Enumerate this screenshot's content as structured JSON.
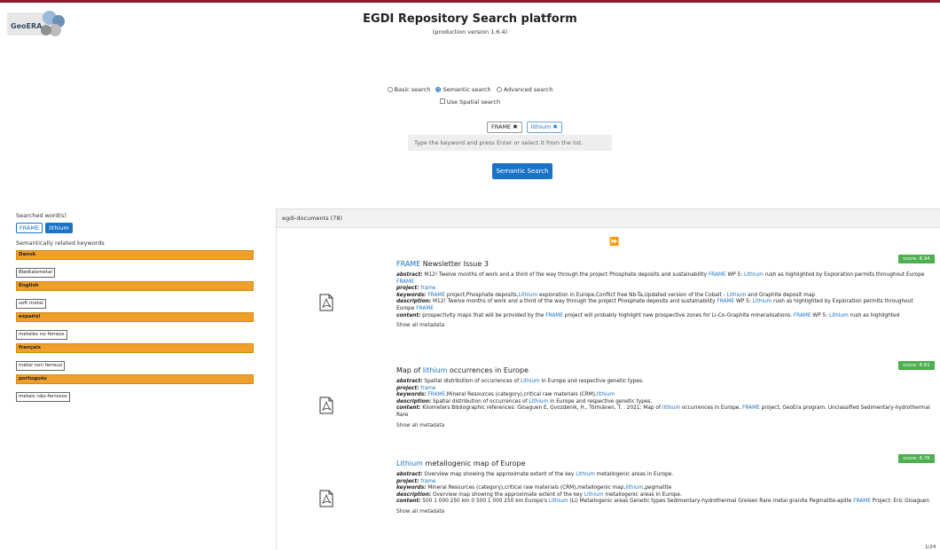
{
  "header": {
    "title": "EGDI Repository Search platform",
    "subtitle": "(production version 1.6.4)",
    "logo_text": "GeoERA"
  },
  "search": {
    "modes": [
      "Basic search",
      "Semantic search",
      "Advanced search"
    ],
    "selected_mode": "Semantic search",
    "spatial_label": "Use Spatial search",
    "chips": [
      "FRAME",
      "lithium"
    ],
    "input_placeholder": "Type the keyword and press Enter or select it from the list.",
    "button_label": "Semantic Search"
  },
  "left_panel": {
    "searched_label": "Searched word(s)",
    "searched_words": [
      "FRAME",
      "lithium"
    ],
    "related_label": "Semantically related keywords",
    "languages": [
      {
        "lang": "Dansk",
        "keywords": [
          "Blødtalsmetal"
        ]
      },
      {
        "lang": "English",
        "keywords": [
          "soft metal"
        ]
      },
      {
        "lang": "español",
        "keywords": [
          "metales no férreos"
        ]
      },
      {
        "lang": "français",
        "keywords": [
          "métal non ferreux"
        ]
      },
      {
        "lang": "português",
        "keywords": [
          "metais não-ferrosos"
        ]
      }
    ]
  },
  "results": {
    "header": "egdi-documents (78)",
    "pager_icon": "fast-forward-icon",
    "show_meta_label": "Show all metadata",
    "items": [
      {
        "title_parts": [
          [
            "FRAME",
            true
          ],
          [
            " Newsletter Issue 3",
            false
          ]
        ],
        "score": "score: 8.94",
        "rows": [
          {
            "k": "abstract:",
            "parts": [
              [
                " M12! Twelve months of work and a third of the way through the project Phosphate deposits and sustainability ",
                false
              ],
              [
                "FRAME",
                true
              ],
              [
                " WP 5: ",
                false
              ],
              [
                "Lithium",
                true
              ],
              [
                " rush as highlighted by Exploration permits throughout Europe ",
                false
              ],
              [
                "FRAME",
                true
              ]
            ]
          },
          {
            "k": "project:",
            "parts": [
              [
                " frame",
                true
              ]
            ]
          },
          {
            "k": "keywords:",
            "parts": [
              [
                " ",
                false
              ],
              [
                "FRAME",
                true
              ],
              [
                " project,Phosphate deposits,",
                false
              ],
              [
                "Lithium",
                true
              ],
              [
                " exploration in Europe,Conflict free Nb-Ta,Updated version of the Cobalt - ",
                false
              ],
              [
                "Lithium",
                true
              ],
              [
                " and Graphite deposit map",
                false
              ]
            ]
          },
          {
            "k": "description:",
            "parts": [
              [
                " M12! Twelve months of work and a third of the way through the project Phosphate deposits and sustainability ",
                false
              ],
              [
                "FRAME",
                true
              ],
              [
                " WP 5: ",
                false
              ],
              [
                "Lithium",
                true
              ],
              [
                " rush as highlighted by Exploration permits throughout Europe ",
                false
              ],
              [
                "FRAME",
                true
              ]
            ]
          },
          {
            "k": "content:",
            "parts": [
              [
                " prospectivity maps that will be provided by the ",
                false
              ],
              [
                "FRAME",
                true
              ],
              [
                " project will probably highlight new prospective zones for Li-Co-Graphite mineralisations. ",
                false
              ],
              [
                "FRAME",
                true
              ],
              [
                " WP 5: ",
                false
              ],
              [
                "Lithium",
                true
              ],
              [
                " rush as highlighted",
                false
              ]
            ]
          }
        ]
      },
      {
        "title_parts": [
          [
            "Map of ",
            false
          ],
          [
            "lithium",
            true
          ],
          [
            " occurrences in Europe",
            false
          ]
        ],
        "score": "score: 8.81",
        "rows": [
          {
            "k": "abstract:",
            "parts": [
              [
                " Spatial distribution of occurrences of ",
                false
              ],
              [
                "Lithium",
                true
              ],
              [
                " in Europe and respective genetic types.",
                false
              ]
            ]
          },
          {
            "k": "project:",
            "parts": [
              [
                " frame",
                true
              ]
            ]
          },
          {
            "k": "keywords:",
            "parts": [
              [
                " ",
                false
              ],
              [
                "FRAME",
                true
              ],
              [
                ",Mineral Resources (category),critical raw materials (CRM),",
                false
              ],
              [
                "lithium",
                true
              ]
            ]
          },
          {
            "k": "description:",
            "parts": [
              [
                " Spatial distribution of occurrences of ",
                false
              ],
              [
                "Lithium",
                true
              ],
              [
                " in Europe and respective genetic types.",
                false
              ]
            ]
          },
          {
            "k": "content:",
            "parts": [
              [
                " Kilometers Bibliographic references: Gloaguen E, Gvozdenik, H., Törmänen, T. . 2021: Map of ",
                false
              ],
              [
                "lithium",
                true
              ],
              [
                " occurrences in Europe, ",
                false
              ],
              [
                "FRAME",
                true
              ],
              [
                " project, GeoEra program. Unclassified Sedimentary-hydrothermal Rare",
                false
              ]
            ]
          }
        ]
      },
      {
        "title_parts": [
          [
            "Lithium",
            true
          ],
          [
            " metallogenic map of Europe",
            false
          ]
        ],
        "score": "score: 8.76",
        "rows": [
          {
            "k": "abstract:",
            "parts": [
              [
                " Overview map showing the approximate extent of the key ",
                false
              ],
              [
                "Lithium",
                true
              ],
              [
                " metallogenic areas in Europe.",
                false
              ]
            ]
          },
          {
            "k": "project:",
            "parts": [
              [
                " frame",
                true
              ]
            ]
          },
          {
            "k": "keywords:",
            "parts": [
              [
                " Mineral Resources (category),critical raw materials (CRM),metallogenic map,",
                false
              ],
              [
                "lithium",
                true
              ],
              [
                ",pegmatite",
                false
              ]
            ]
          },
          {
            "k": "description:",
            "parts": [
              [
                " Overview map showing the approximate extent of the key ",
                false
              ],
              [
                "Lithium",
                true
              ],
              [
                " metallogenic areas in Europe.",
                false
              ]
            ]
          },
          {
            "k": "content:",
            "parts": [
              [
                " 500 1 000 250 km 0 500 1 000 250 km Europe's ",
                false
              ],
              [
                "Lithium",
                true
              ],
              [
                " (Li) Metallogenic areas Genetic types Sedimentary-hydrothermal Greisen Rare metal granite Pegmatite-aplite ",
                false
              ],
              [
                "FRAME",
                true
              ],
              [
                " Project: Eric Gloaguen",
                false
              ]
            ]
          }
        ]
      }
    ],
    "page_count": "1/24"
  }
}
